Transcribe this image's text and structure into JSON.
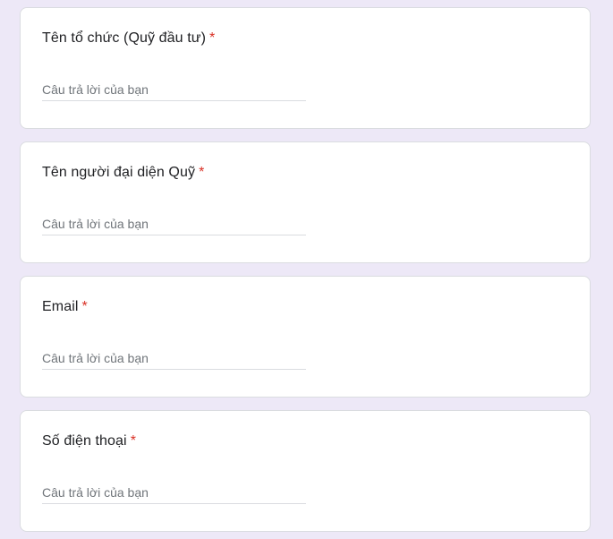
{
  "colors": {
    "page_background": "#ede8f7",
    "card_background": "#ffffff",
    "required_marker": "#d93025"
  },
  "questions": [
    {
      "title": "Tên tổ chức (Quỹ đầu tư)",
      "required_mark": "*",
      "answer_placeholder": "Câu trả lời của bạn",
      "answer_value": ""
    },
    {
      "title": "Tên người đại diện Quỹ",
      "required_mark": "*",
      "answer_placeholder": "Câu trả lời của bạn",
      "answer_value": ""
    },
    {
      "title": "Email",
      "required_mark": "*",
      "answer_placeholder": "Câu trả lời của bạn",
      "answer_value": ""
    },
    {
      "title": "Số điện thoại",
      "required_mark": "*",
      "answer_placeholder": "Câu trả lời của bạn",
      "answer_value": ""
    }
  ]
}
